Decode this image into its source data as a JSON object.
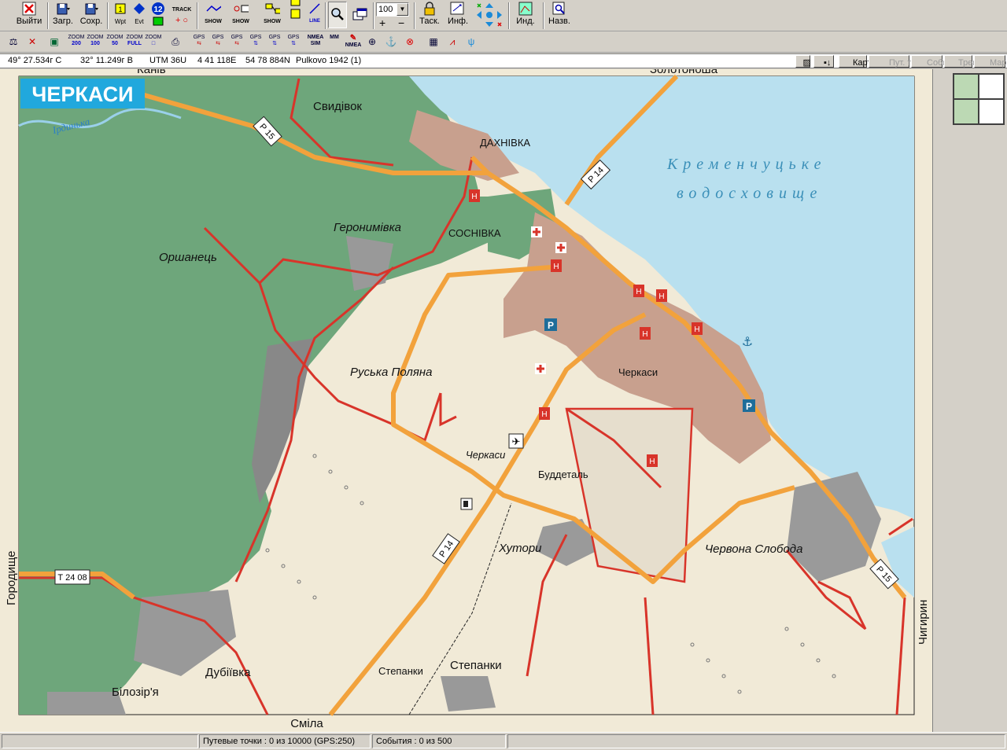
{
  "toolbar": {
    "exit_label": "Выйти",
    "load_label": "Загр.",
    "save_label": "Сохр.",
    "wpt_label": "Wpt",
    "evt_label": "Evt",
    "count_badge": "12",
    "track_label": "TRACK",
    "show1_label": "SHOW",
    "show2_label": "SHOW",
    "show3_label": "SHOW",
    "line_label": "LINE",
    "scale_value": "100",
    "plus_label": "+",
    "minus_label": "−",
    "task_label": "Таск.",
    "info_label": "Инф.",
    "ind_label": "Инд.",
    "name_label": "Назв."
  },
  "toolbar2": {
    "zoom_items": [
      {
        "top": "ZOOM",
        "bottom": "200"
      },
      {
        "top": "ZOOM",
        "bottom": "100"
      },
      {
        "top": "ZOOM",
        "bottom": "50"
      },
      {
        "top": "ZOOM",
        "bottom": "FULL"
      },
      {
        "top": "ZOOM",
        "bottom": "FULL"
      }
    ],
    "gps_label": "GPS",
    "nmea_sim": "NMEA SIM",
    "mm_label": "MM",
    "nmea_label": "NMEA"
  },
  "coords": {
    "lat": "49° 27.534г С",
    "lon": "32° 11.249г В",
    "utm": "UTM  36U",
    "easting": "4 41 118E",
    "northing": "54 78 884N",
    "datum": "Pulkovo 1942 (1)"
  },
  "tabs": [
    {
      "label": "Карта",
      "enabled": true
    },
    {
      "label": "Пут. точ.",
      "enabled": false
    },
    {
      "label": "Событ.",
      "enabled": false
    },
    {
      "label": "Трек.",
      "enabled": false
    },
    {
      "label": "Марш.",
      "enabled": false
    }
  ],
  "map": {
    "title": "ЧЕРКАСИ",
    "edge_top_left": "Канів",
    "edge_top_right": "Золотоноша",
    "edge_left": "Городище",
    "edge_right": "Чигирин",
    "edge_bottom": "Сміла",
    "reservoir_1": "Кременчуцьке",
    "reservoir_2": "водосховище",
    "river": "Ірдинька",
    "places": {
      "svydivok": "Свидівок",
      "dakhnivka": "ДАХНІВКА",
      "sosnivka": "СОСНІВКА",
      "heronymivka": "Геронимівка",
      "orshanets": "Оршанець",
      "ruska_poliana": "Руська Поляна",
      "cherkasy_airport": "Черкаси",
      "cherkasy_city": "Черкаси",
      "buddetal": "Буддеталь",
      "khutory": "Хутори",
      "chervona_sloboda": "Червона Слобода",
      "stepanky_1": "Степанки",
      "stepanky_2": "Степанки",
      "dubiivka": "Дубіївка",
      "bilozirya": "Білозір'я"
    },
    "roads": {
      "p15_a": "Р 15",
      "p14_a": "Р 14",
      "p14_b": "Р 14",
      "p15_b": "Р 15",
      "t2408": "Т 24 08"
    }
  },
  "statusbar": {
    "waypoints": "Путевые точки : 0 из 10000  (GPS:250)",
    "events": "События : 0 из 500"
  },
  "colors": {
    "forest": "#5f9e6e",
    "water": "#b9e0ef",
    "land": "#f1ead7",
    "road_main": "#f2a23c",
    "road_red": "#d8342a",
    "urban": "#c8a08e",
    "title_bg": "#21a8dd"
  }
}
